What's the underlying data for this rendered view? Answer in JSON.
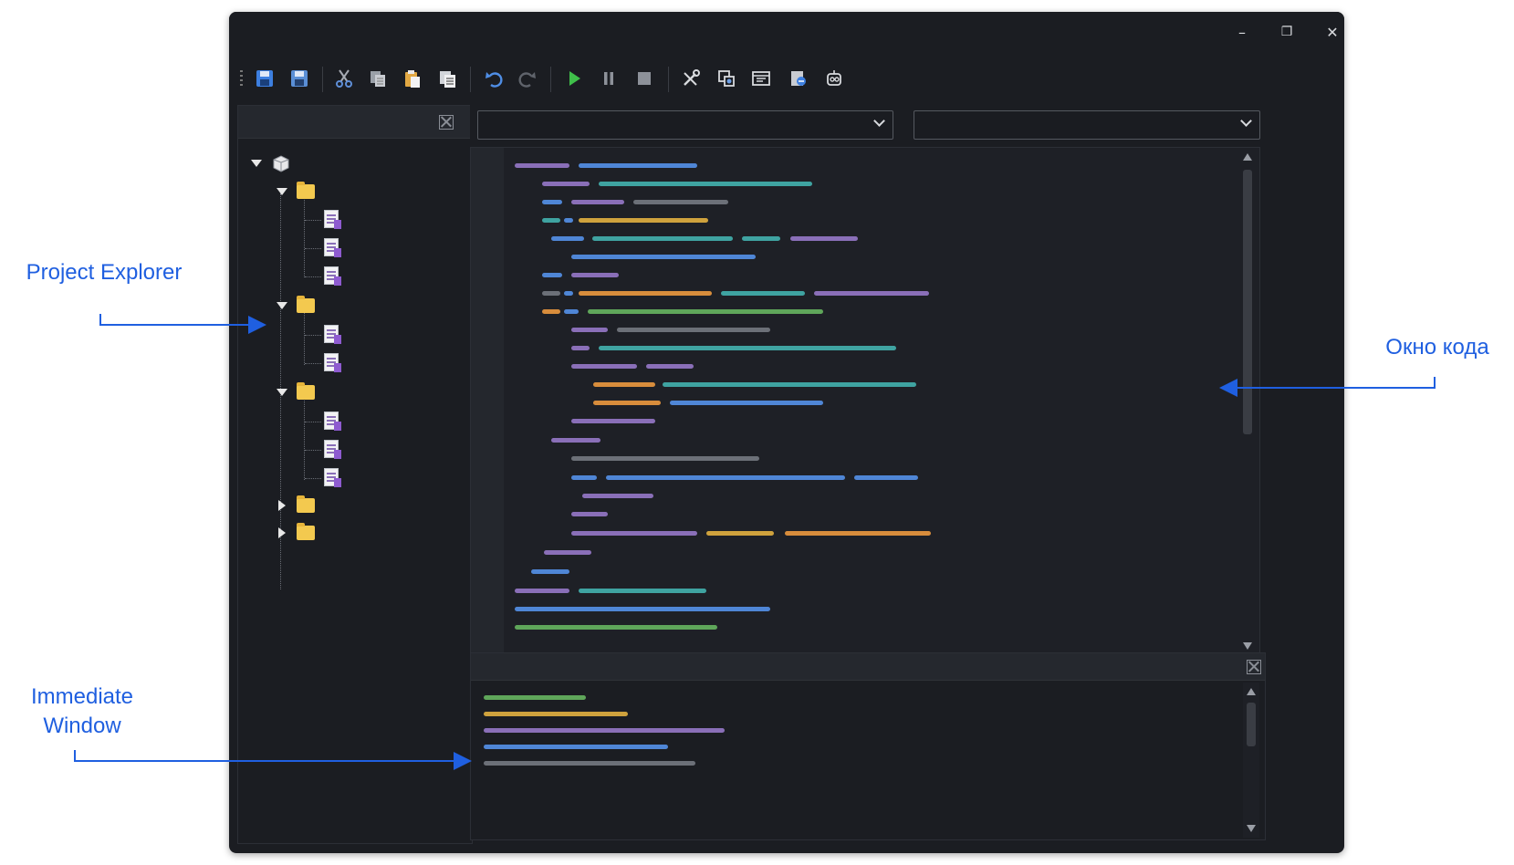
{
  "annotations": {
    "project_explorer": "Project Explorer",
    "code_window": "Окно кода",
    "immediate_window_line1": "Immediate",
    "immediate_window_line2": "Window"
  },
  "window_controls": {
    "minimize": "–",
    "maximize": "❐",
    "close": "✕"
  },
  "toolbar_icons": [
    "save-icon",
    "save-all-icon",
    "cut-icon",
    "copy-icon",
    "paste-icon",
    "paste-special-icon",
    "undo-icon",
    "redo-icon",
    "run-icon",
    "pause-icon",
    "stop-icon",
    "tools-icon",
    "object-browser-icon",
    "properties-icon",
    "watch-icon",
    "debug-icon"
  ],
  "colors": {
    "accent_annotation": "#1f5fe0",
    "purple": "#8a6fb8",
    "blue": "#4f86d6",
    "teal": "#3fa3a1",
    "gray": "#6c7078",
    "orange": "#d88d3c",
    "yellow": "#cfa23d",
    "green": "#5fa65a",
    "run_green": "#3fbf4a"
  },
  "combos": {
    "object": "",
    "procedure": ""
  }
}
